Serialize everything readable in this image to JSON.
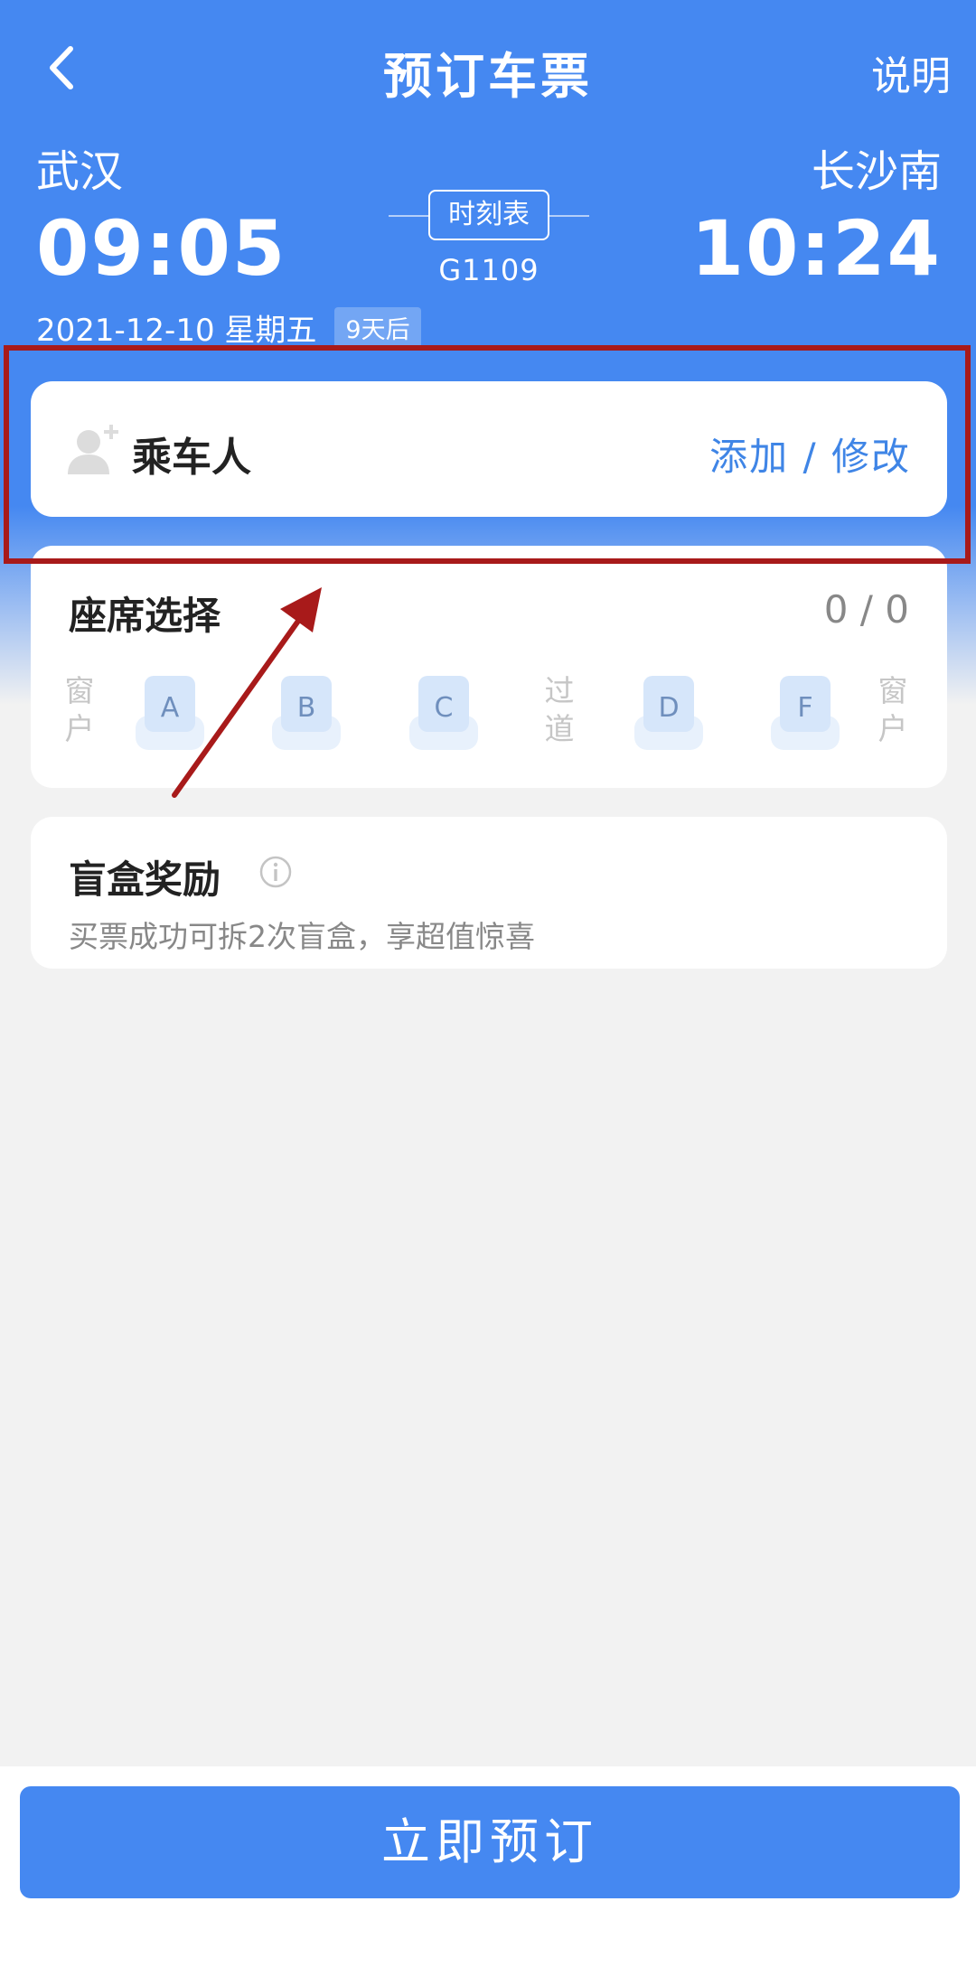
{
  "header": {
    "title": "预订车票",
    "help_label": "说明"
  },
  "trip": {
    "from_station": "武汉",
    "to_station": "长沙南",
    "departure_time": "09:05",
    "arrival_time": "10:24",
    "schedule_label": "时刻表",
    "train_number": "G1109",
    "date": "2021-12-10 星期五",
    "days_until": "9天后"
  },
  "passenger": {
    "label": "乘车人",
    "action": "添加 / 修改"
  },
  "seat_selection": {
    "title": "座席选择",
    "count": "0 / 0",
    "window_label": "窗户",
    "aisle_label": "过道",
    "seats": [
      "A",
      "B",
      "C",
      "D",
      "F"
    ]
  },
  "blind_box": {
    "title": "盲盒奖励",
    "subtitle": "买票成功可拆2次盲盒，享超值惊喜"
  },
  "book_button_label": "立即预订",
  "colors": {
    "primary": "#4588f1",
    "link": "#3f85e6",
    "annotation": "#a81a1a"
  }
}
